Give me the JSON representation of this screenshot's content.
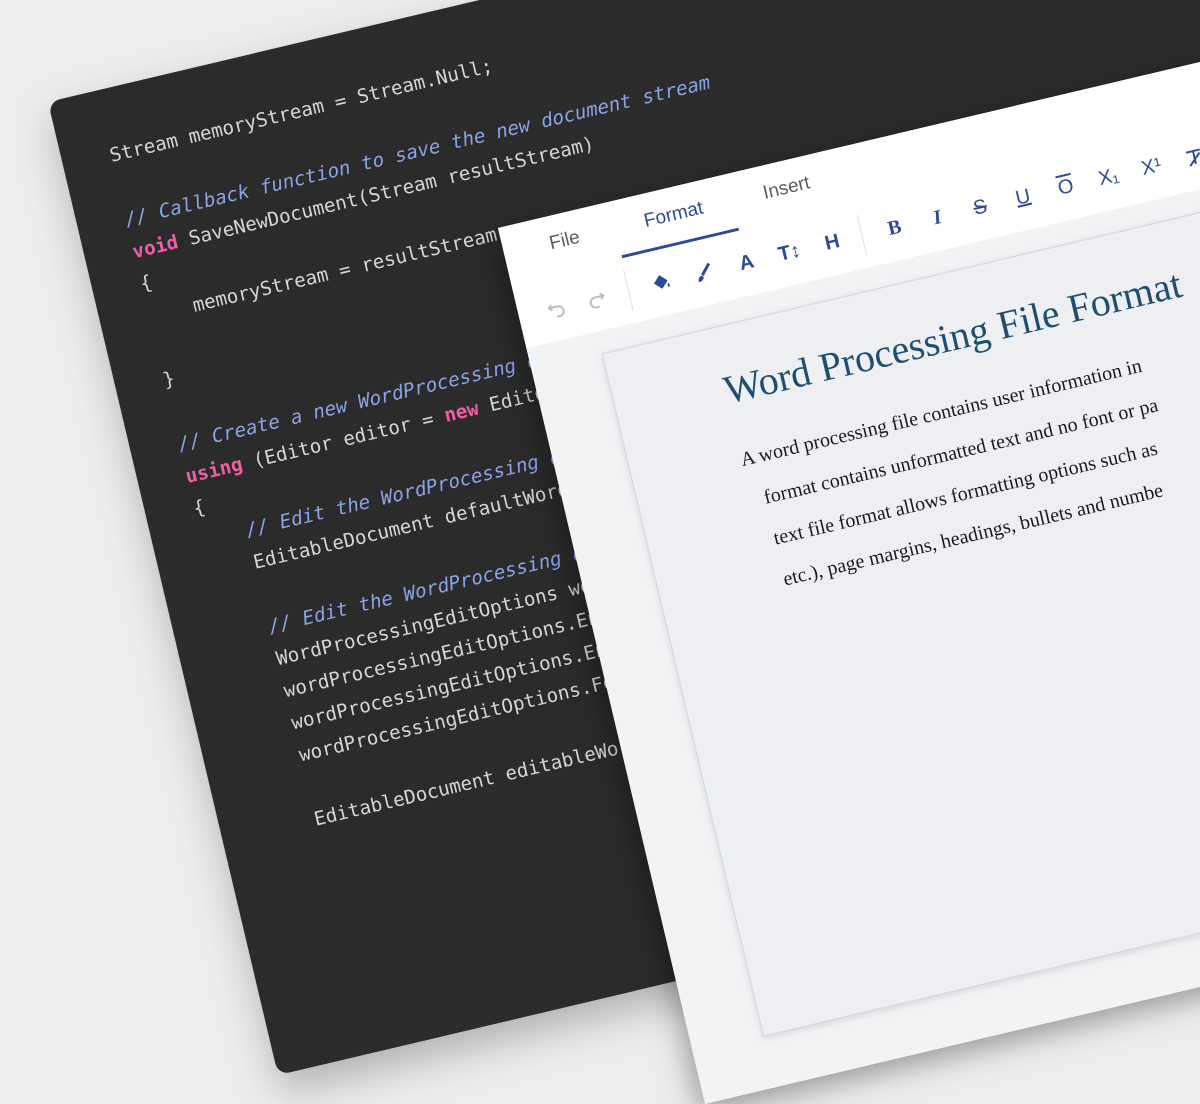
{
  "code": {
    "lines": [
      [
        {
          "c": "plain",
          "t": "Stream memoryStream = Stream.Null;"
        }
      ],
      [
        {
          "c": "plain",
          "t": ""
        }
      ],
      [
        {
          "c": "comment",
          "t": "// Callback function to save the new document stream"
        }
      ],
      [
        {
          "c": "keyword",
          "t": "void"
        },
        {
          "c": "plain",
          "t": " SaveNewDocument(Stream resultStream)"
        }
      ],
      [
        {
          "c": "plain",
          "t": "{"
        }
      ],
      [
        {
          "c": "plain",
          "t": "    memoryStream = resultStream;"
        }
      ],
      [
        {
          "c": "plain",
          "t": ""
        }
      ],
      [
        {
          "c": "plain",
          "t": "}"
        }
      ],
      [
        {
          "c": "plain",
          "t": ""
        }
      ],
      [
        {
          "c": "comment",
          "t": "// Create a new WordProcessing d"
        }
      ],
      [
        {
          "c": "keyword",
          "t": "using"
        },
        {
          "c": "plain",
          "t": " (Editor editor = "
        },
        {
          "c": "keyword",
          "t": "new"
        },
        {
          "c": "plain",
          "t": " Editor"
        }
      ],
      [
        {
          "c": "plain",
          "t": "{"
        }
      ],
      [
        {
          "c": "comment",
          "t": "    // Edit the WordProcessing d"
        }
      ],
      [
        {
          "c": "plain",
          "t": "    EditableDocument defaultWord"
        }
      ],
      [
        {
          "c": "plain",
          "t": ""
        }
      ],
      [
        {
          "c": "comment",
          "t": "    // Edit the WordProcessing d"
        }
      ],
      [
        {
          "c": "plain",
          "t": "    WordProcessingEditOptions wo"
        }
      ],
      [
        {
          "c": "plain",
          "t": "    wordProcessingEditOptions.En"
        }
      ],
      [
        {
          "c": "plain",
          "t": "    wordProcessingEditOptions.En"
        }
      ],
      [
        {
          "c": "plain",
          "t": "    wordProcessingEditOptions.Fo"
        }
      ],
      [
        {
          "c": "plain",
          "t": ""
        }
      ],
      [
        {
          "c": "plain",
          "t": "    EditableDocument editableWor"
        }
      ]
    ]
  },
  "editor": {
    "tabs": [
      {
        "label": "File",
        "active": false
      },
      {
        "label": "Format",
        "active": true
      },
      {
        "label": "Insert",
        "active": false
      }
    ],
    "toolbar": {
      "undo_icon": "undo-icon",
      "redo_icon": "redo-icon",
      "fill_color_icon": "paint-bucket-icon",
      "brush_icon": "brush-icon",
      "font_label": "A",
      "font_size_label": "T↕",
      "heading_label": "H",
      "bold_label": "B",
      "italic_label": "I",
      "strike_label": "S",
      "underline_label": "U",
      "overline_label": "O",
      "subscript_label": "X₁",
      "superscript_label": "X¹",
      "clear_format_icon": "clear-format-icon"
    },
    "document": {
      "title": "Word Processing File Format",
      "lines": [
        "A word processing file contains user information in",
        "format contains unformatted text and no font or pa",
        "text file format allows formatting options such as",
        "etc.), page margins, headings, bullets and numbe"
      ]
    }
  },
  "colors": {
    "accent": "#2e4a97",
    "code_bg": "#2b2b2c",
    "comment": "#8aa5e6",
    "keyword": "#ee5fa8",
    "title": "#1f4e6e"
  }
}
